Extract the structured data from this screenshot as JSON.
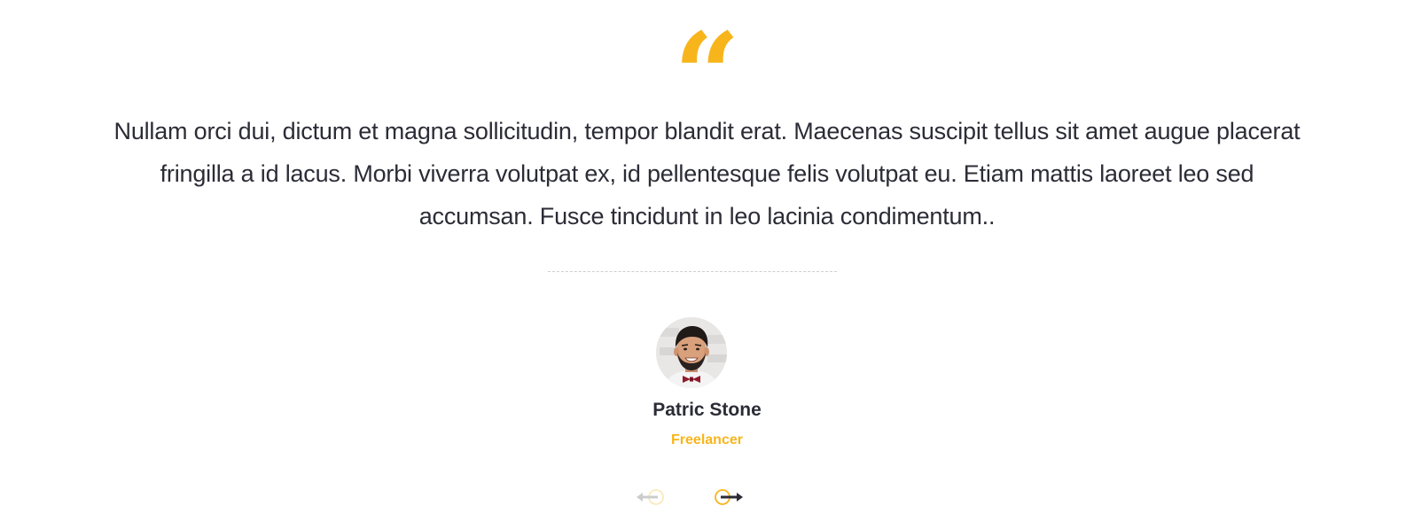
{
  "testimonial": {
    "quote_icon": "quote-open-icon",
    "quote_glyph": "“",
    "text": "Nullam orci dui, dictum et magna sollicitudin, tempor blandit erat. Maecenas suscipit tellus sit amet augue placerat fringilla a id lacus. Morbi viverra volutpat ex, id pellentesque felis volutpat eu. Etiam mattis laoreet leo sed accumsan. Fusce tincidunt in leo lacinia condimentum..",
    "author": {
      "name": "Patric Stone",
      "role": "Freelancer",
      "avatar_icon": "avatar-photo"
    }
  },
  "navigation": {
    "prev_icon": "arrow-left-icon",
    "next_icon": "arrow-right-icon"
  },
  "colors": {
    "accent": "#f7b51b",
    "text": "#2c2c37",
    "muted_arrow": "#cccccc",
    "divider": "#cfcfcf"
  }
}
